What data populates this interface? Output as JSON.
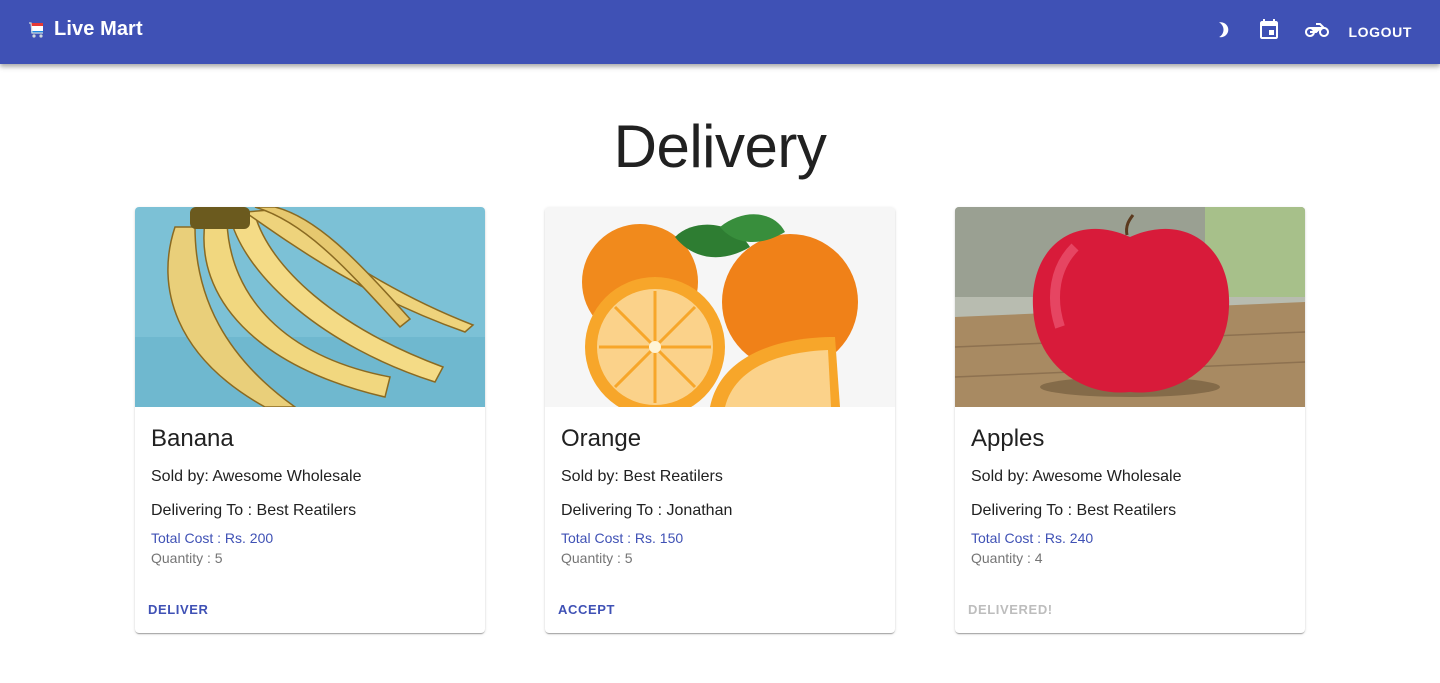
{
  "app": {
    "title": "Live Mart",
    "logo_icon": "shopping-cart-icon"
  },
  "toolbar": {
    "icons": [
      "dark-mode-icon",
      "calendar-icon",
      "delivery-bike-icon"
    ],
    "logout_label": "LOGOUT"
  },
  "page": {
    "title": "Delivery"
  },
  "colors": {
    "primary": "#3f51b5",
    "disabled": "#bdbdbd",
    "muted": "#757575"
  },
  "cards": [
    {
      "name": "Banana",
      "image_icon": "banana-image",
      "sold_by": "Sold by: Awesome Wholesale",
      "delivering_to": "Delivering To : Best Reatilers",
      "total_cost": "Total Cost : Rs. 200",
      "quantity": "Quantity : 5",
      "action": "DELIVER",
      "action_enabled": true
    },
    {
      "name": "Orange",
      "image_icon": "orange-image",
      "sold_by": "Sold by: Best Reatilers",
      "delivering_to": "Delivering To : Jonathan",
      "total_cost": "Total Cost : Rs. 150",
      "quantity": "Quantity : 5",
      "action": "ACCEPT",
      "action_enabled": true
    },
    {
      "name": "Apples",
      "image_icon": "apple-image",
      "sold_by": "Sold by: Awesome Wholesale",
      "delivering_to": "Delivering To : Best Reatilers",
      "total_cost": "Total Cost : Rs. 240",
      "quantity": "Quantity : 4",
      "action": "DELIVERED!",
      "action_enabled": false
    }
  ]
}
